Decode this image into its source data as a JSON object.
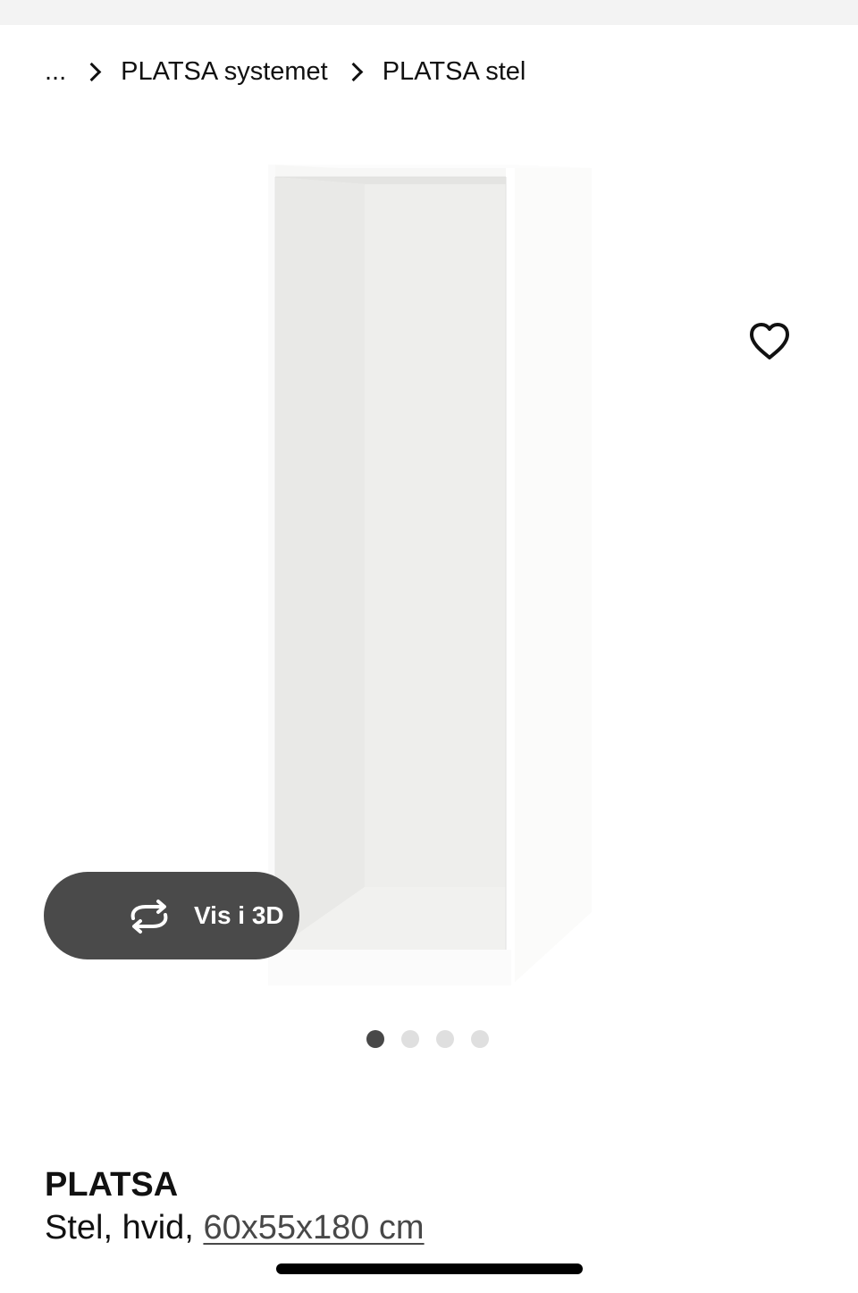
{
  "breadcrumb": {
    "items": [
      {
        "label": "..."
      },
      {
        "label": "PLATSA systemet"
      },
      {
        "label": "PLATSA stel"
      }
    ]
  },
  "media": {
    "favorite_icon": "heart-icon",
    "view3d": {
      "icon": "rotate-arrows-icon",
      "label": "Vis i 3D"
    },
    "carousel": {
      "count": 4,
      "active_index": 0
    }
  },
  "product": {
    "name": "PLATSA",
    "desc_prefix": "Stel, hvid,",
    "size": "60x55x180 cm"
  },
  "colors": {
    "text": "#111111",
    "button_dark": "#4a4a4a",
    "dot_active": "#484848",
    "dot_inactive": "#dfdfdf"
  }
}
